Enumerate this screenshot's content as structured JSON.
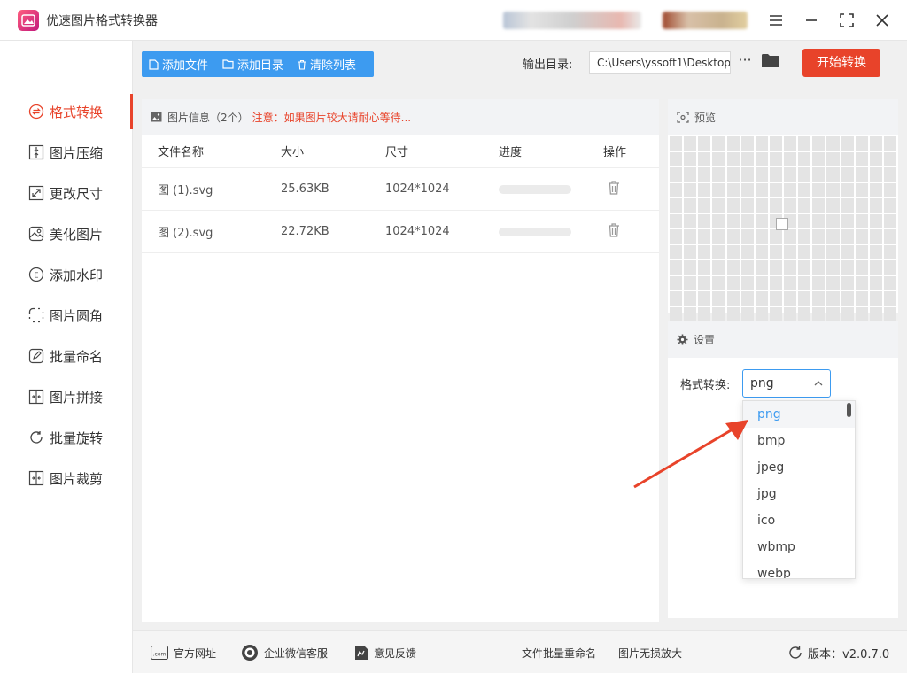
{
  "app": {
    "title": "优速图片格式转换器"
  },
  "sidebar": {
    "items": [
      {
        "label": "格式转换",
        "icon": "convert-icon"
      },
      {
        "label": "图片压缩",
        "icon": "compress-icon"
      },
      {
        "label": "更改尺寸",
        "icon": "resize-icon"
      },
      {
        "label": "美化图片",
        "icon": "beautify-icon"
      },
      {
        "label": "添加水印",
        "icon": "watermark-icon"
      },
      {
        "label": "图片圆角",
        "icon": "rounded-corner-icon"
      },
      {
        "label": "批量命名",
        "icon": "rename-icon"
      },
      {
        "label": "图片拼接",
        "icon": "stitch-icon"
      },
      {
        "label": "批量旋转",
        "icon": "rotate-icon"
      },
      {
        "label": "图片裁剪",
        "icon": "crop-icon"
      }
    ]
  },
  "toolbar": {
    "add_file": "添加文件",
    "add_dir": "添加目录",
    "clear_list": "清除列表",
    "output_label": "输出目录:",
    "output_path": "C:\\Users\\yssoft1\\Desktop",
    "more": "···",
    "start": "开始转换"
  },
  "files": {
    "header_title": "图片信息（2个）",
    "header_warning": "注意：如果图片较大请耐心等待...",
    "columns": [
      "文件名称",
      "大小",
      "尺寸",
      "进度",
      "操作"
    ],
    "rows": [
      {
        "name": "图 (1).svg",
        "size": "25.63KB",
        "dims": "1024*1024",
        "progress": 0
      },
      {
        "name": "图 (2).svg",
        "size": "22.72KB",
        "dims": "1024*1024",
        "progress": 0
      }
    ]
  },
  "preview": {
    "title": "预览"
  },
  "settings": {
    "title": "设置",
    "format_label": "格式转换:",
    "format_value": "png",
    "options": [
      "png",
      "bmp",
      "jpeg",
      "jpg",
      "ico",
      "wbmp",
      "webp"
    ]
  },
  "footer": {
    "website": "官方网址",
    "wechat": "企业微信客服",
    "feedback": "意见反馈",
    "batch_rename": "文件批量重命名",
    "lossless": "图片无损放大",
    "version": "版本：v2.0.7.0"
  },
  "colors": {
    "accent": "#e8432a",
    "primary": "#3d9bf0"
  }
}
